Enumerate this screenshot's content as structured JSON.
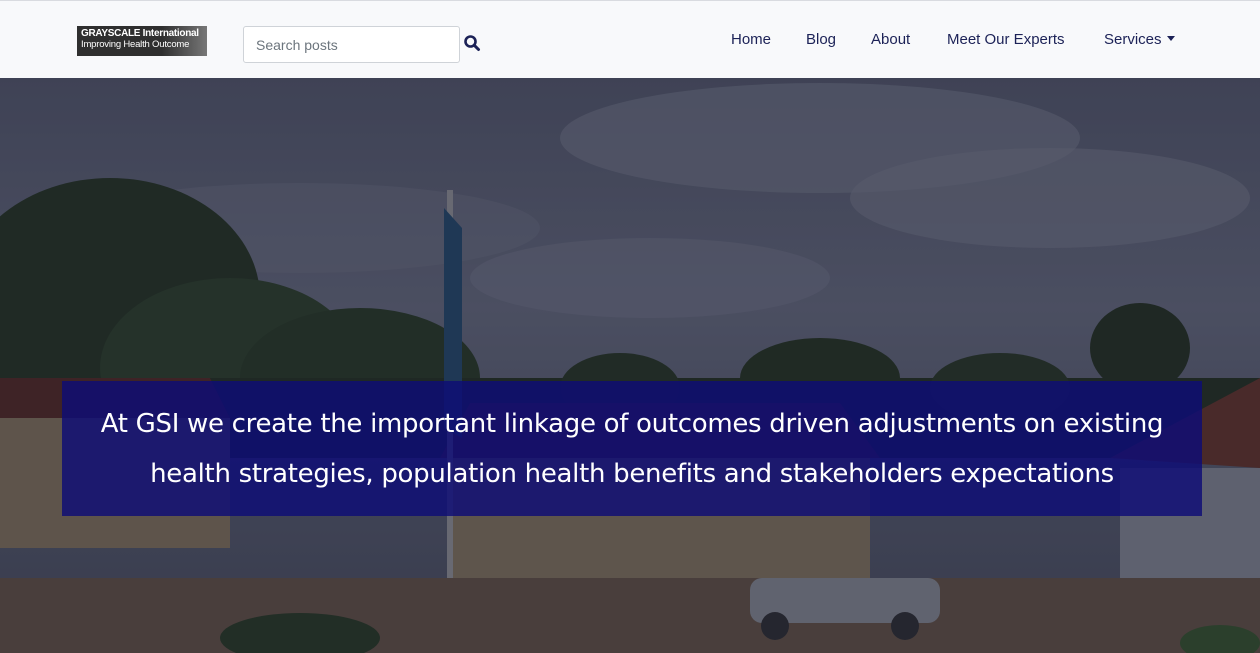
{
  "header": {
    "logo": {
      "line1": "GRAYSCALE International",
      "line2": "Improving Health Outcome"
    },
    "search": {
      "placeholder": "Search posts",
      "icon": "search-icon"
    },
    "nav": [
      {
        "label": "Home"
      },
      {
        "label": "Blog"
      },
      {
        "label": "About"
      },
      {
        "label": "Meet Our Experts"
      },
      {
        "label": "Services",
        "dropdown": true
      }
    ]
  },
  "hero": {
    "tagline": "At GSI we create the important linkage of outcomes driven adjustments on existing health strategies, population health benefits and stakeholders expectations"
  },
  "colors": {
    "nav_text": "#1c2257",
    "banner_bg": "#0e0c76",
    "navbar_bg": "#f8f9fb"
  }
}
